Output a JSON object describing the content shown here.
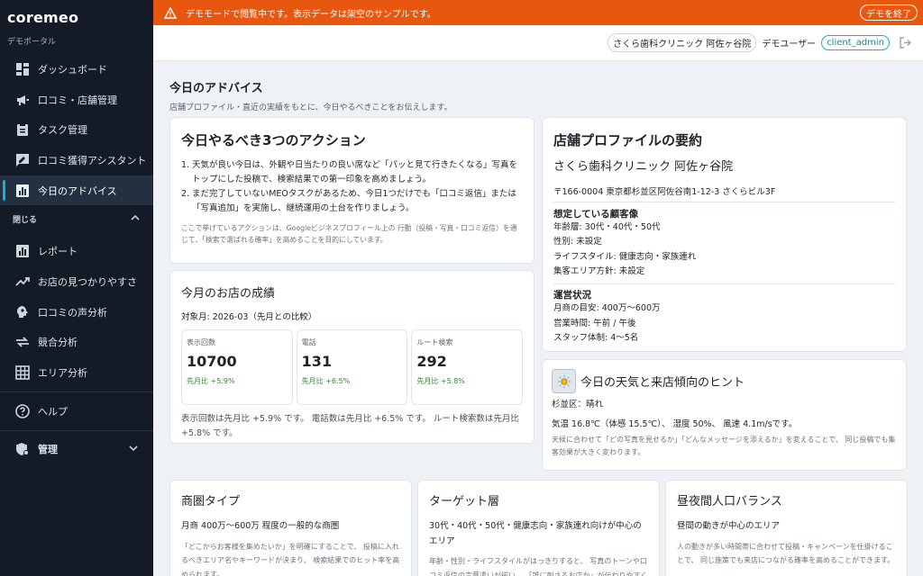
{
  "brand": {
    "name": "coremeo",
    "subtitle": "デモポータル"
  },
  "sidebar": {
    "items": [
      {
        "label": "ダッシュボード",
        "icon": "dashboard-icon"
      },
      {
        "label": "口コミ・店舗管理",
        "icon": "megaphone-icon"
      },
      {
        "label": "タスク管理",
        "icon": "clipboard-icon"
      },
      {
        "label": "口コミ獲得アシスタント",
        "icon": "rate-review-icon"
      },
      {
        "label": "今日のアドバイス",
        "icon": "bar-chart-icon",
        "active": true
      }
    ],
    "section_label": "閉じる",
    "section_items": [
      {
        "label": "レポート",
        "icon": "chart-icon"
      },
      {
        "label": "お店の見つかりやすさ",
        "icon": "trending-up-icon"
      },
      {
        "label": "口コミの声分析",
        "icon": "insight-icon"
      },
      {
        "label": "競合分析",
        "icon": "compare-icon"
      },
      {
        "label": "エリア分析",
        "icon": "grid-icon"
      }
    ],
    "help_label": "ヘルプ",
    "admin_label": "管理"
  },
  "banner": {
    "text": "デモモードで閲覧中です。表示データは架空のサンプルです。",
    "button": "デモを終了"
  },
  "header": {
    "store": "さくら歯科クリニック 阿佐ヶ谷院",
    "user_label": "デモユーザー",
    "user_id": "client_admin"
  },
  "page": {
    "title": "今日のアドバイス",
    "subtitle": "店舗プロファイル・直近の実績をもとに、今日やるべきことをお伝えします。"
  },
  "actions": {
    "title": "今日やるべき3つのアクション",
    "items": [
      "天気が良い今日は、外観や日当たりの良い席など「パッと見て行きたくなる」写真をトップにした投稿で、検索結果での第一印象を高めましょう。",
      "まだ完了していないMEOタスクがあるため、今日1つだけでも「口コミ返信」または「写真追加」を実施し、継続運用の土台を作りましょう。"
    ],
    "note": "ここで挙げているアクションは、Googleビジネスプロフィール上の 行動（投稿・写真・口コミ返信）を通じて、「検索で選ばれる確率」を高めることを目的にしています。"
  },
  "performance": {
    "title": "今月のお店の成績",
    "period": "対象月: 2026-03（先月との比較）",
    "metrics": [
      {
        "label": "表示回数",
        "value": "10700",
        "change": "先月比 +5.9%"
      },
      {
        "label": "電話",
        "value": "131",
        "change": "先月比 +6.5%"
      },
      {
        "label": "ルート検索",
        "value": "292",
        "change": "先月比 +5.8%"
      }
    ],
    "note": "表示回数は先月比 +5.9% です。 電話数は先月比 +6.5% です。 ルート検索数は先月比 +5.8% です。"
  },
  "profile": {
    "title": "店舗プロファイルの要約",
    "name": "さくら歯科クリニック 阿佐ヶ谷院",
    "address": "〒166-0004 東京都杉並区阿佐谷南1-12-3 さくらビル3F",
    "customers_title": "想定している顧客像",
    "customers": [
      "年齢層: 30代・40代・50代",
      "性別: 未設定",
      "ライフスタイル: 健康志向・家族連れ",
      "集客エリア方針: 未設定"
    ],
    "ops_title": "運営状況",
    "ops": [
      "月商の目安: 400万〜600万",
      "営業時間: 午前 / 午後",
      "スタッフ体制: 4〜5名"
    ]
  },
  "weather": {
    "title": "今日の天気と来店傾向のヒント",
    "area": "杉並区：晴れ",
    "stats": "気温 16.8℃（体感 15.5℃）、 湿度 50%、 風速 4.1m/sです。",
    "note": "天候に合わせて「どの写真を見せるか」「どんなメッセージを添えるか」を変えることで、 同じ投稿でも集客効果が大きく変わります。"
  },
  "bottom": [
    {
      "title": "商圏タイプ",
      "lead": "月商 400万〜600万 程度の一般的な商圏",
      "note": "「どこからお客様を集めたいか」を明確にすることで、 投稿に入れるべきエリア名やキーワードが決まり、 検索結果でのヒット率を高められます。"
    },
    {
      "title": "ターゲット層",
      "lead": "30代・40代・50代・健康志向・家族連れ向けが中心のエリア",
      "note": "年齢・性別・ライフスタイルがはっきりすると、 写真のトーンや口コミ返信の言葉遣いが揃い、 「誰に刺さるお店か」が伝わりやすくなります。"
    },
    {
      "title": "昼夜間人口バランス",
      "lead": "昼間の動きが中心のエリア",
      "note": "人の動きが多い時間帯に合わせて投稿・キャンペーンを仕掛けることで、 同じ施策でも来店につながる確率を高めることができます。"
    }
  ]
}
